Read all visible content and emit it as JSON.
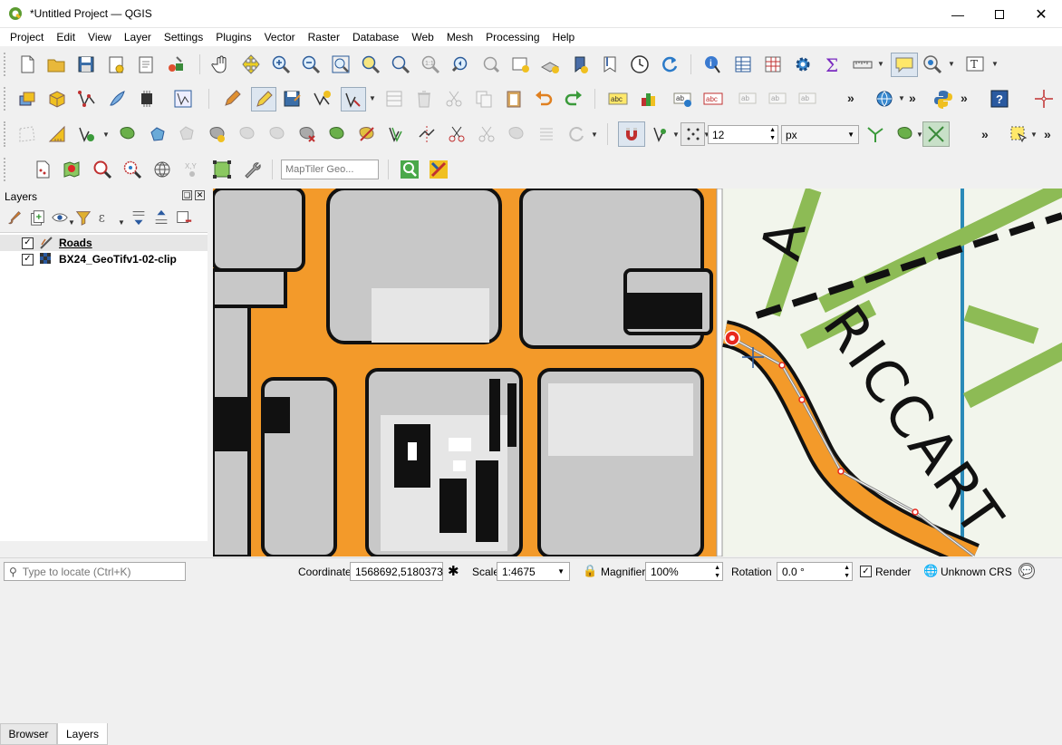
{
  "window": {
    "title": "*Untitled Project — QGIS",
    "controls": [
      "minimize-icon",
      "maximize-icon",
      "close-icon"
    ]
  },
  "menu": [
    "Project",
    "Edit",
    "View",
    "Layer",
    "Settings",
    "Plugins",
    "Vector",
    "Raster",
    "Database",
    "Web",
    "Mesh",
    "Processing",
    "Help"
  ],
  "digitizing": {
    "snapping_tolerance": "12",
    "snapping_units": "px"
  },
  "locator_toolbar": {
    "geocoder_placeholder": "MapTiler Geo..."
  },
  "layers_panel": {
    "title": "Layers",
    "layers": [
      {
        "name": "Roads",
        "checked": true,
        "icon": "line-layer-icon"
      },
      {
        "name": "BX24_GeoTifv1-02-clip",
        "checked": true,
        "icon": "raster-layer-icon"
      }
    ],
    "tabs": [
      "Browser",
      "Layers"
    ],
    "active_tab": "Layers"
  },
  "map_labels": [
    "A",
    "RICCART"
  ],
  "statusbar": {
    "locate_placeholder": "Type to locate (Ctrl+K)",
    "coordinate_label": "Coordinate",
    "coordinate_value": "1568692,5180373",
    "scale_label": "Scale",
    "scale_value": "1:4675",
    "magnifier_label": "Magnifier",
    "magnifier_value": "100%",
    "rotation_label": "Rotation",
    "rotation_value": "0.0 °",
    "render_label": "Render",
    "render_checked": true,
    "crs_label": "Unknown CRS"
  },
  "colors": {
    "road_orange": "#f39a2a",
    "building_gray": "#c8c8c8",
    "park_green": "#8dbb55",
    "water_blue": "#2a8ab8",
    "digitize_red": "#e8281e",
    "titlebar_bg": "#ffffff"
  }
}
